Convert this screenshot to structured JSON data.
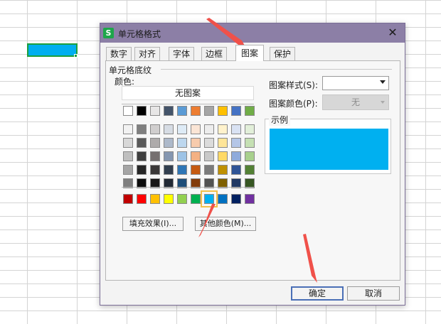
{
  "dialog": {
    "title": "单元格格式",
    "app_icon_letter": "S",
    "close_symbol": "✕"
  },
  "tabs": [
    {
      "label": "数字",
      "active": false
    },
    {
      "label": "对齐",
      "active": false
    },
    {
      "label": "字体",
      "active": false
    },
    {
      "label": "边框",
      "active": false
    },
    {
      "label": "图案",
      "active": true
    },
    {
      "label": "保护",
      "active": false
    }
  ],
  "shading": {
    "group_label": "单元格底纹",
    "color_label": "颜色:",
    "no_pattern_label": "无图案",
    "fill_effects_label": "填充效果(I)...",
    "more_colors_label": "其他颜色(M)...",
    "selected_color": "#00b0f0",
    "palette_top": [
      "#ffffff",
      "#000000",
      "#e7e6e6",
      "#44546a",
      "#5b9bd5",
      "#ed7d31",
      "#a5a5a5",
      "#ffc000",
      "#4472c4",
      "#70ad47"
    ],
    "palette_shades": [
      [
        "#f2f2f2",
        "#7f7f7f",
        "#d0cece",
        "#d6dce4",
        "#deebf6",
        "#fbe5d5",
        "#ededed",
        "#fff2cc",
        "#d9e2f3",
        "#e2efd9"
      ],
      [
        "#d8d8d8",
        "#595959",
        "#aeabab",
        "#adb9ca",
        "#bdd7ee",
        "#f7cbac",
        "#dbdbdb",
        "#fee599",
        "#b4c6e7",
        "#c5e0b3"
      ],
      [
        "#bfbfbf",
        "#3f3f3f",
        "#757070",
        "#8496b0",
        "#9dc3e6",
        "#f4b183",
        "#c9c9c9",
        "#ffd966",
        "#8eaadb",
        "#a8d08d"
      ],
      [
        "#a5a5a5",
        "#262626",
        "#3a3838",
        "#323f4f",
        "#2e75b5",
        "#c55a11",
        "#7b7b7b",
        "#bf9000",
        "#2f5496",
        "#538135"
      ],
      [
        "#7f7f7f",
        "#0c0c0c",
        "#171616",
        "#222a35",
        "#1e4e79",
        "#833c0b",
        "#525252",
        "#7f6000",
        "#1f3864",
        "#375623"
      ]
    ],
    "palette_standard": [
      "#c00000",
      "#ff0000",
      "#ffc000",
      "#ffff00",
      "#92d050",
      "#00b050",
      "#00b0f0",
      "#0070c0",
      "#002060",
      "#7030a0"
    ],
    "selected_index_standard": 6
  },
  "pattern": {
    "style_label": "图案样式(S):",
    "style_value": "",
    "color_label": "图案颜色(P):",
    "color_value": "无"
  },
  "sample": {
    "label": "示例",
    "fill": "#00b0f0"
  },
  "buttons": {
    "ok": "确定",
    "cancel": "取消"
  },
  "sheet": {
    "selected_cell_fill": "#00aeef",
    "selection_border": "#1e9f3c"
  },
  "annotation_color": "#f0514a"
}
